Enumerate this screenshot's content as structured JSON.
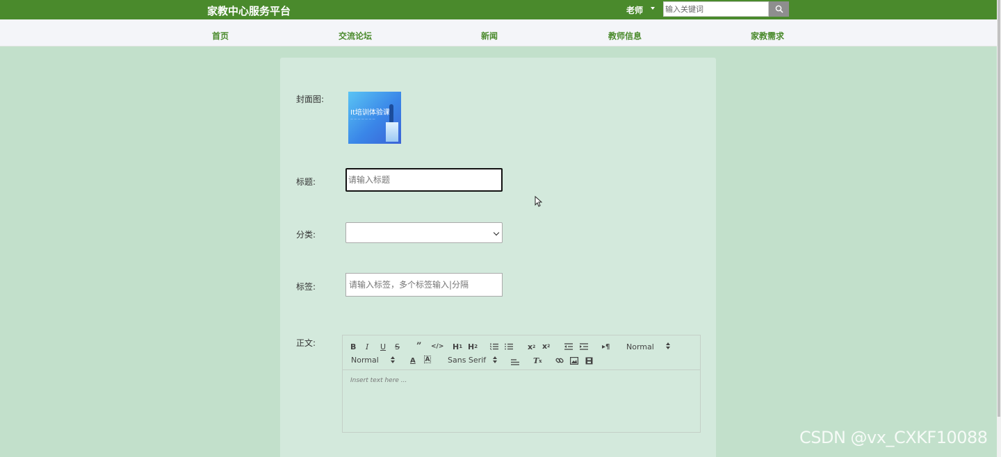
{
  "header": {
    "brand": "家教中心服务平台",
    "user": "老师",
    "search_placeholder": "输入关键词"
  },
  "nav": [
    "首页",
    "交流论坛",
    "新闻",
    "教师信息",
    "家教需求"
  ],
  "form": {
    "cover_label": "封面图:",
    "cover_image_title": "It培训体验课",
    "title_label": "标题:",
    "title_placeholder": "请输入标题",
    "category_label": "分类:",
    "category_value": "",
    "tags_label": "标签:",
    "tags_placeholder": "请输入标签，多个标签输入|分隔",
    "body_label": "正文:"
  },
  "editor": {
    "header_select": "Normal",
    "size_select": "Normal",
    "font_select": "Sans Serif",
    "placeholder": "Insert text here ..."
  },
  "watermark": "CSDN @vx_CXKF10088",
  "colors": {
    "header_bg": "#4a8a2c",
    "nav_text": "#4a8a2c",
    "page_bg": "#c2e0cb",
    "panel_bg": "#d3e9dc"
  }
}
